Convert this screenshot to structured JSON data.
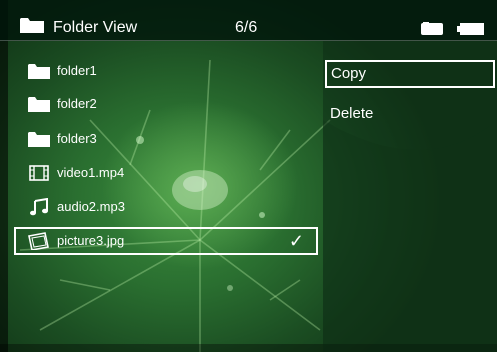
{
  "header": {
    "title": "Folder View",
    "count": "6/6",
    "icons": [
      "folder-icon",
      "storage-icon",
      "battery-icon"
    ]
  },
  "files": [
    {
      "label": "folder1",
      "type": "folder"
    },
    {
      "label": "folder2",
      "type": "folder"
    },
    {
      "label": "folder3",
      "type": "folder"
    },
    {
      "label": "video1.mp4",
      "type": "video"
    },
    {
      "label": "audio2.mp3",
      "type": "audio"
    },
    {
      "label": "picture3.jpg",
      "type": "picture",
      "selected": true,
      "checked": true
    }
  ],
  "check_mark": "✓",
  "menu": {
    "items": [
      {
        "label": "Copy",
        "active": true
      },
      {
        "label": "Delete",
        "active": false
      }
    ]
  },
  "colors": {
    "highlight_border": "#ffffff",
    "text": "#ffffff",
    "background": "#2a6f30"
  }
}
